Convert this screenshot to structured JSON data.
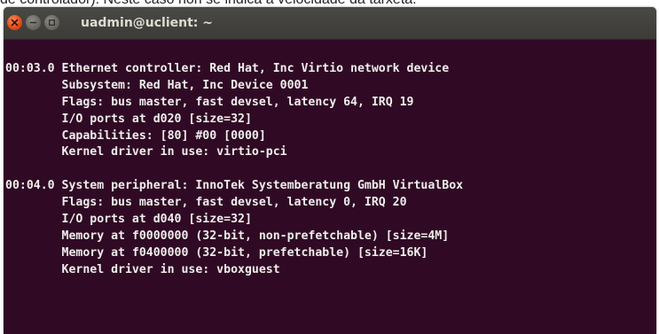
{
  "caption": {
    "text": "de controlador). Neste caso non se indica a velocidade da tarxeta."
  },
  "window": {
    "title": "uadmin@uclient: ~",
    "buttons": {
      "close": "close-icon",
      "minimize": "minimize-icon",
      "maximize": "maximize-icon"
    },
    "colors": {
      "terminal_background": "#300a24",
      "terminal_text": "#eeeeec",
      "titlebar": "#3c3b37",
      "close_button": "#df4a16"
    }
  },
  "terminal": {
    "lines": [
      "00:03.0 Ethernet controller: Red Hat, Inc Virtio network device",
      "        Subsystem: Red Hat, Inc Device 0001",
      "        Flags: bus master, fast devsel, latency 64, IRQ 19",
      "        I/O ports at d020 [size=32]",
      "        Capabilities: [80] #00 [0000]",
      "        Kernel driver in use: virtio-pci",
      "",
      "00:04.0 System peripheral: InnoTek Systemberatung GmbH VirtualBox",
      "        Flags: bus master, fast devsel, latency 0, IRQ 20",
      "        I/O ports at d040 [size=32]",
      "        Memory at f0000000 (32-bit, non-prefetchable) [size=4M]",
      "        Memory at f0400000 (32-bit, prefetchable) [size=16K]",
      "        Kernel driver in use: vboxguest"
    ]
  }
}
